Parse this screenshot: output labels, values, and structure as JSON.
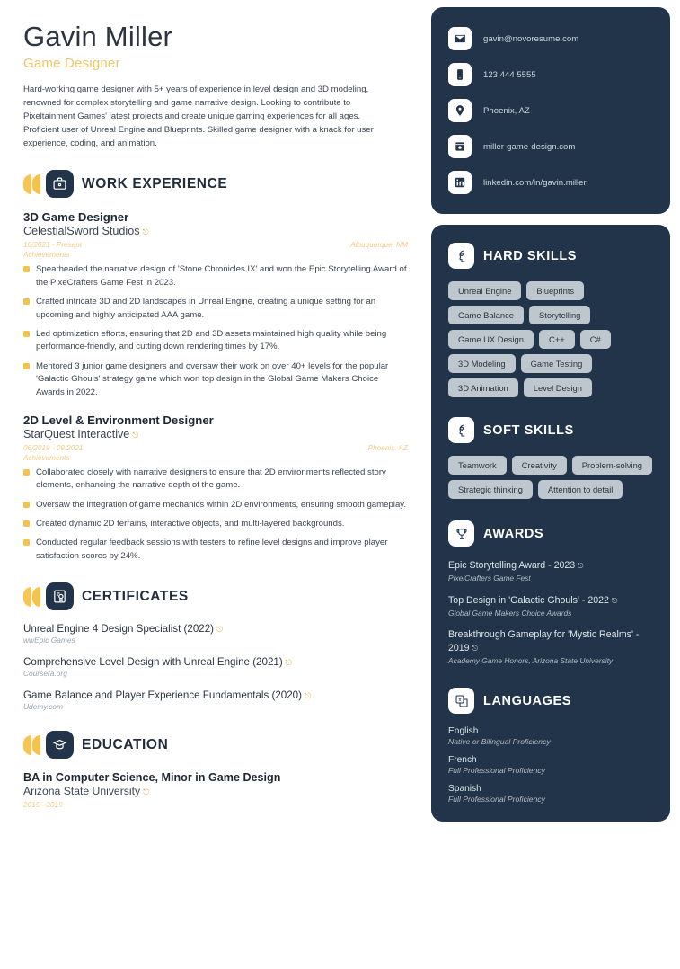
{
  "header": {
    "name": "Gavin Miller",
    "role": "Game Designer",
    "summary": "Hard-working game designer with 5+ years of experience in level design and 3D modeling, renowned for complex storytelling and game narrative design. Looking to contribute to Pixeltainment Games' latest projects and create unique gaming experiences for all ages. Proficient user of Unreal Engine and Blueprints. Skilled game designer with a knack for user experience, coding, and animation."
  },
  "colors": {
    "accent_yellow": "#f5c24c",
    "panel_navy": "#223449",
    "tag_grey": "#bfc7ce",
    "role_gold": "#efc567"
  },
  "contact": {
    "items": [
      {
        "icon": "envelope-icon",
        "value": "gavin@novoresume.com"
      },
      {
        "icon": "phone-icon",
        "value": "123 444 5555"
      },
      {
        "icon": "location-pin-icon",
        "value": "Phoenix, AZ"
      },
      {
        "icon": "website-icon",
        "value": "miller-game-design.com"
      },
      {
        "icon": "linkedin-icon",
        "value": "linkedin.com/in/gavin.miller"
      }
    ]
  },
  "work_experience": {
    "title": "WORK EXPERIENCE",
    "icon": "briefcase-icon",
    "jobs": [
      {
        "title": "3D Game Designer",
        "org": "CelestialSword Studios",
        "dates": "10/2021 - Present",
        "location": "Albuquerque, NM",
        "achievements_label": "Achievements",
        "bullets": [
          "Spearheaded the narrative design of 'Stone Chronicles IX' and won the Epic Storytelling Award of the PixeCrafters Game Fest in 2023.",
          "Crafted intricate 3D and 2D landscapes in Unreal Engine, creating a unique setting for an upcoming and highly anticipated AAA game.",
          "Led optimization efforts, ensuring that 2D and 3D assets maintained high quality while being performance-friendly, and cutting down rendering times by 17%.",
          "Mentored 3 junior game designers and oversaw their work on over 40+ levels for the popular 'Galactic Ghouls' strategy game which won top design in the Global Game Makers Choice Awards in 2022."
        ]
      },
      {
        "title": "2D Level & Environment Designer",
        "org": "StarQuest Interactive",
        "dates": "06/2019 - 09/2021",
        "location": "Phoenix, AZ",
        "achievements_label": "Achievements",
        "bullets": [
          "Collaborated closely with narrative designers to ensure that 2D environments reflected story elements, enhancing the narrative depth of the game.",
          "Oversaw the integration of game mechanics within 2D environments, ensuring smooth gameplay.",
          "Created dynamic 2D terrains, interactive objects, and multi-layered backgrounds.",
          "Conducted regular feedback sessions with testers to refine level designs and improve player satisfaction scores by 24%."
        ]
      }
    ]
  },
  "certificates": {
    "title": "CERTIFICATES",
    "icon": "certificate-icon",
    "items": [
      {
        "title": "Unreal Engine 4 Design Specialist (2022)",
        "issuer": "wwEpic Games"
      },
      {
        "title": "Comprehensive Level Design with Unreal Engine (2021)",
        "issuer": "Coursera.org"
      },
      {
        "title": "Game Balance and Player Experience Fundamentals (2020)",
        "issuer": "Udemy.com"
      }
    ]
  },
  "education": {
    "title": "EDUCATION",
    "icon": "graduation-cap-icon",
    "items": [
      {
        "degree": "BA in Computer Science, Minor in Game Design",
        "school": "Arizona State University",
        "dates": "2015 - 2019"
      }
    ]
  },
  "hard_skills": {
    "title": "HARD SKILLS",
    "icon": "gears-head-icon",
    "tags": [
      "Unreal Engine",
      "Blueprints",
      "Game Balance",
      "Storytelling",
      "Game UX Design",
      "C++",
      "C#",
      "3D Modeling",
      "Game Testing",
      "3D Animation",
      "Level Design"
    ]
  },
  "soft_skills": {
    "title": "SOFT SKILLS",
    "icon": "lightbulb-head-icon",
    "tags": [
      "Teamwork",
      "Creativity",
      "Problem-solving",
      "Strategic thinking",
      "Attention to detail"
    ]
  },
  "awards": {
    "title": "AWARDS",
    "icon": "trophy-icon",
    "items": [
      {
        "title": "Epic Storytelling Award - 2023",
        "issuer": "PixelCrafters Game Fest"
      },
      {
        "title": "Top Design in 'Galactic Ghouls' - 2022",
        "issuer": "Global Game Makers Choice Awards"
      },
      {
        "title": "Breakthrough Gameplay for 'Mystic Realms' - 2019",
        "issuer": "Academy Game Honors, Arizona State University"
      }
    ]
  },
  "languages": {
    "title": "LANGUAGES",
    "icon": "translate-icon",
    "items": [
      {
        "name": "English",
        "level": "Native or Bilingual Proficiency"
      },
      {
        "name": "French",
        "level": "Full Professional Proficiency"
      },
      {
        "name": "Spanish",
        "level": "Full Professional Proficiency"
      }
    ]
  }
}
